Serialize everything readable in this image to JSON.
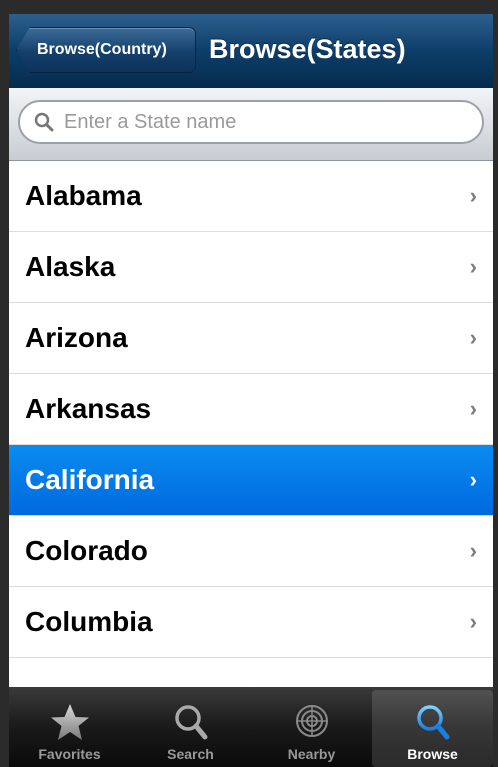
{
  "navbar": {
    "back_label": "Browse(Country)",
    "title": "Browse(States)"
  },
  "search": {
    "placeholder": "Enter a State name"
  },
  "states": [
    {
      "label": "Alabama"
    },
    {
      "label": "Alaska"
    },
    {
      "label": "Arizona"
    },
    {
      "label": "Arkansas"
    },
    {
      "label": "California",
      "selected": true
    },
    {
      "label": "Colorado"
    },
    {
      "label": "Columbia"
    }
  ],
  "chevron": "›",
  "tabs": [
    {
      "label": "Favorites",
      "icon": "star-icon"
    },
    {
      "label": "Search",
      "icon": "magnifier-icon"
    },
    {
      "label": "Nearby",
      "icon": "radar-icon"
    },
    {
      "label": "Browse",
      "icon": "magnifier-icon",
      "active": true
    }
  ],
  "colors": {
    "navbar": "#0d3e6a",
    "selected_row": "#0069de",
    "tab_active_icon": "#2fa3ff"
  }
}
